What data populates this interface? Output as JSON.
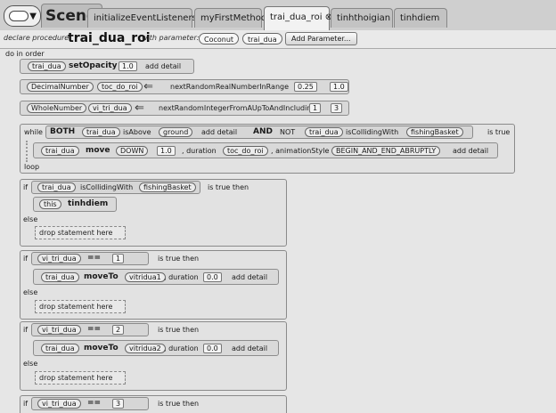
{
  "tabs": {
    "scene": "Scene",
    "items": [
      "initializeEventListeners",
      "myFirstMethod",
      "trai_dua_roi",
      "tinhthoigian",
      "tinhdiem"
    ],
    "active_close": "⊗"
  },
  "procedure": {
    "declare_label": "declare procedure",
    "name": "trai_dua_roi",
    "with_param_label": "with parameter:",
    "param_type": "Coconut",
    "param_name": "trai_dua",
    "add_param_button": "Add Parameter..."
  },
  "editor": {
    "do_in_order": "do in order",
    "set_opacity": {
      "target": "trai_dua",
      "method": "setOpacity",
      "value": "1.0",
      "detail": "add detail"
    },
    "var1": {
      "type": "DecimalNumber",
      "name": "toc_do_roi",
      "fn": "nextRandomRealNumberInRange",
      "a": "0.25",
      "b": "1.0"
    },
    "var2": {
      "type": "WholeNumber",
      "name": "vi_tri_dua",
      "fn": "nextRandomIntegerFromAUpToAndIncludingB",
      "a": "1",
      "b": "3"
    },
    "while_block": {
      "kw_while": "while",
      "kw_both": "BOTH",
      "kw_and": "AND",
      "kw_not": "NOT",
      "kw_is_true": "is true",
      "kw_loop": "loop",
      "cond1_target": "trai_dua",
      "cond1_method": "isAbove",
      "cond1_arg": "ground",
      "cond1_detail": "add detail",
      "cond2_target": "trai_dua",
      "cond2_method": "isCollidingWith",
      "cond2_arg": "fishingBasket",
      "move_target": "trai_dua",
      "move_method": "move",
      "move_dir": "DOWN",
      "move_amount": "1.0",
      "duration_label": ", duration",
      "duration_val": "toc_do_roi",
      "anim_label": ", animationStyle",
      "anim_val": "BEGIN_AND_END_ABRUPTLY",
      "detail": "add detail"
    },
    "if1": {
      "kw_if": "if",
      "target": "trai_dua",
      "method": "isCollidingWith",
      "arg": "fishingBasket",
      "is_true_then": "is true then",
      "this": "this",
      "call": "tinhdiem",
      "else": "else",
      "drop": "drop statement here"
    },
    "if2": {
      "kw_if": "if",
      "var": "vi_tri_dua",
      "op": "==",
      "val": "1",
      "is_true_then": "is true then",
      "target": "trai_dua",
      "method": "moveTo",
      "arg": "vitridua1",
      "duration_label": ", duration",
      "duration": "0.0",
      "detail": "add detail",
      "else": "else",
      "drop": "drop statement here"
    },
    "if3": {
      "kw_if": "if",
      "var": "vi_tri_dua",
      "op": "==",
      "val": "2",
      "is_true_then": "is true then",
      "target": "trai_dua",
      "method": "moveTo",
      "arg": "vitridua2",
      "duration_label": ", duration",
      "duration": "0.0",
      "detail": "add detail",
      "else": "else",
      "drop": "drop statement here"
    },
    "if4": {
      "kw_if": "if",
      "var": "vi_tri_dua",
      "op": "==",
      "val": "3",
      "is_true_then": "is true then"
    }
  }
}
